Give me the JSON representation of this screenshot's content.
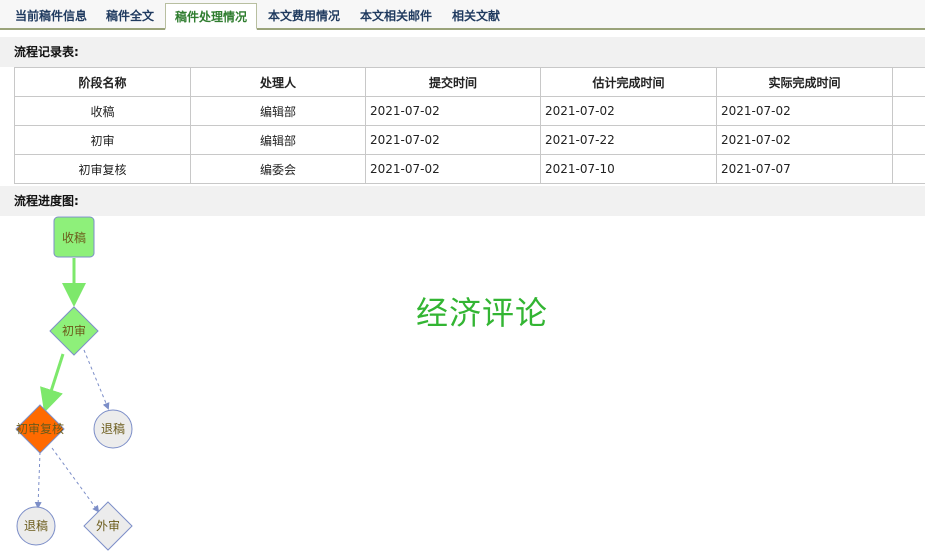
{
  "tabs": [
    {
      "label": "当前稿件信息",
      "active": false
    },
    {
      "label": "稿件全文",
      "active": false
    },
    {
      "label": "稿件处理情况",
      "active": true
    },
    {
      "label": "本文费用情况",
      "active": false
    },
    {
      "label": "本文相关邮件",
      "active": false
    },
    {
      "label": "相关文献",
      "active": false
    }
  ],
  "records": {
    "title": "流程记录表:",
    "headers": [
      "阶段名称",
      "处理人",
      "提交时间",
      "估计完成时间",
      "实际完成时间"
    ],
    "rows": [
      [
        "收稿",
        "编辑部",
        "2021-07-02",
        "2021-07-02",
        "2021-07-02"
      ],
      [
        "初审",
        "编辑部",
        "2021-07-02",
        "2021-07-22",
        "2021-07-02"
      ],
      [
        "初审复核",
        "编委会",
        "2021-07-02",
        "2021-07-10",
        "2021-07-07"
      ]
    ]
  },
  "flow": {
    "title": "流程进度图:",
    "journal_name": "经济评论",
    "nodes": {
      "receive": "收稿",
      "first_review": "初审",
      "reject1": "退稿",
      "recheck": "初审复核",
      "reject2": "退稿",
      "external": "外审"
    },
    "colors": {
      "done": "#8ef07a",
      "current": "#ff6a00",
      "pending": "#ececec",
      "border": "#7c8ec8",
      "done_arrow": "#7de86b",
      "dashed_arrow": "#7c8ec8"
    }
  }
}
